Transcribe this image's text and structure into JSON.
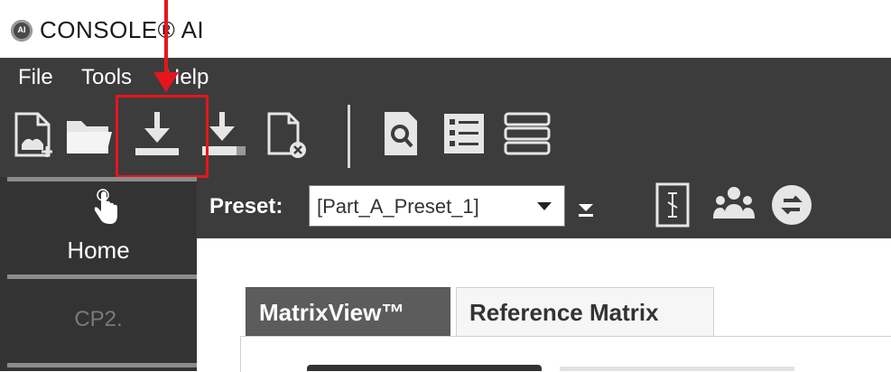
{
  "app": {
    "title": "CONSOLE® AI",
    "logo_text": "AI"
  },
  "menu": {
    "items": [
      "File",
      "Tools",
      "Help"
    ]
  },
  "toolbar": {
    "buttons": [
      "new-file-icon",
      "open-folder-icon",
      "download-icon",
      "download-alt-icon",
      "remove-file-icon",
      "search-document-icon",
      "list-view-icon",
      "stack-icon"
    ]
  },
  "sidebar": {
    "home_label": "Home",
    "cp2_label": "CP2."
  },
  "preset": {
    "label": "Preset:",
    "value": "[Part_A_Preset_1]"
  },
  "tabs": [
    {
      "label": "MatrixView™",
      "active": true
    },
    {
      "label": "Reference Matrix",
      "active": false
    }
  ],
  "colors": {
    "chrome": "#3c3c3c",
    "accent_red": "#e8141c"
  }
}
